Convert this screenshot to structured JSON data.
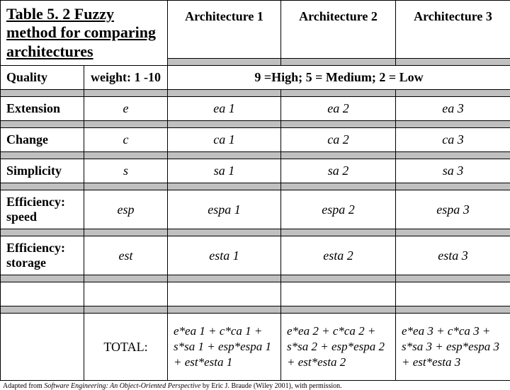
{
  "title": "Table 5. 2 Fuzzy method for comparing architectures",
  "arch_headers": [
    "Architecture 1",
    "Architecture 2",
    "Architecture 3"
  ],
  "quality_label": "Quality",
  "weight_label": "weight: 1 -10",
  "scale_label": "9 =High; 5 = Medium; 2 = Low",
  "rows": [
    {
      "name": "Extension",
      "w": "e",
      "a1": "ea 1",
      "a2": "ea 2",
      "a3": "ea 3"
    },
    {
      "name": "Change",
      "w": "c",
      "a1": "ca 1",
      "a2": "ca 2",
      "a3": "ca 3"
    },
    {
      "name": "Simplicity",
      "w": "s",
      "a1": "sa 1",
      "a2": "sa 2",
      "a3": "sa 3"
    },
    {
      "name": "Efficiency: speed",
      "w": "esp",
      "a1": "espa 1",
      "a2": "espa 2",
      "a3": "espa 3"
    },
    {
      "name": "Efficiency: storage",
      "w": "est",
      "a1": "esta 1",
      "a2": "esta 2",
      "a3": "esta 3"
    }
  ],
  "total_label": "TOTAL:",
  "totals": [
    "e*ea 1 + c*ca 1 + s*sa 1 + esp*espa 1 + est*esta 1",
    "e*ea 2 + c*ca 2 + s*sa 2 + esp*espa 2 + est*esta 2",
    "e*ea 3 + c*ca 3 + s*sa 3 + esp*espa 3 + est*esta 3"
  ],
  "footnote_prefix": "Adapted from ",
  "footnote_title": "Software Engineering: An Object-Oriented Perspective",
  "footnote_suffix": " by Eric J. Braude (Wiley 2001), with permission."
}
